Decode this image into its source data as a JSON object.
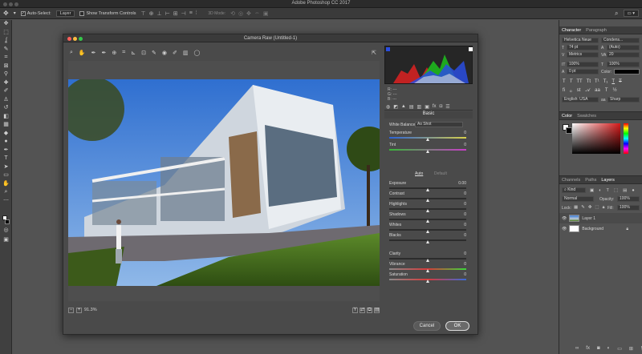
{
  "app": {
    "title": "Adobe Photoshop CC 2017"
  },
  "options_bar": {
    "auto_select_label": "Auto-Select:",
    "auto_select_value": "Layer",
    "transform_label": "Show Transform Controls",
    "mode_3d": "3D Mode:"
  },
  "character_panel": {
    "tabs": [
      "Character",
      "Paragraph"
    ],
    "font_family": "Helvetica Neue",
    "font_style": "Condens...",
    "font_size": "74 pt",
    "leading": "(Auto)",
    "kerning": "Metrics",
    "tracking": "20",
    "vertical_scale": "100%",
    "horizontal_scale": "100%",
    "baseline": "0 pt",
    "color_label": "Color:",
    "language": "English: USA",
    "antialias": "Sharp",
    "aa": "aa"
  },
  "color_panel": {
    "tabs": [
      "Color",
      "Swatches"
    ]
  },
  "layers_panel": {
    "tabs": [
      "Channels",
      "Paths",
      "Layers"
    ],
    "filter_label": "Kind",
    "blend_mode": "Normal",
    "opacity_label": "Opacity:",
    "opacity_value": "100%",
    "lock_label": "Lock:",
    "fill_label": "Fill:",
    "fill_value": "100%",
    "layers": [
      {
        "name": "Layer 1"
      },
      {
        "name": "Background"
      }
    ]
  },
  "camera_raw": {
    "title": "Camera Raw (Untitled-1)",
    "zoom": "91.3%",
    "rgb_labels": [
      "R:",
      "G:",
      "B:"
    ],
    "rgb_values": [
      "---",
      "---",
      "---"
    ],
    "section_title": "Basic",
    "white_balance_label": "White Balance:",
    "white_balance_value": "As Shot",
    "auto_label": "Auto",
    "default_label": "Default",
    "sliders": [
      {
        "label": "Temperature",
        "value": "0",
        "position": 0.5
      },
      {
        "label": "Tint",
        "value": "0",
        "position": 0.5
      },
      {
        "label": "Exposure",
        "value": "0.00",
        "position": 0.5
      },
      {
        "label": "Contrast",
        "value": "0",
        "position": 0.5
      },
      {
        "label": "Highlights",
        "value": "0",
        "position": 0.5
      },
      {
        "label": "Shadows",
        "value": "0",
        "position": 0.5
      },
      {
        "label": "Whites",
        "value": "0",
        "position": 0.5
      },
      {
        "label": "Blacks",
        "value": "0",
        "position": 0.5
      },
      {
        "label": "Clarity",
        "value": "0",
        "position": 0.5
      },
      {
        "label": "Vibrance",
        "value": "0",
        "position": 0.5
      },
      {
        "label": "Saturation",
        "value": "0",
        "position": 0.5
      }
    ],
    "cancel_label": "Cancel",
    "ok_label": "OK"
  },
  "colors": {
    "accent": "#1473e6",
    "sky": "#3a7bd5",
    "grass": "#4c7a1e"
  }
}
